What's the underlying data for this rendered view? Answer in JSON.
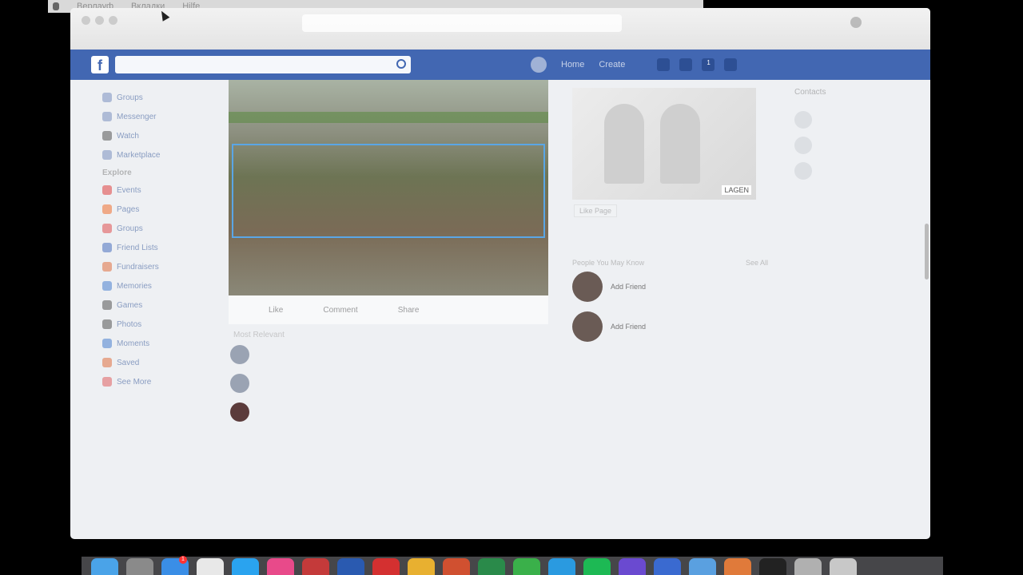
{
  "menubar": {
    "items": [
      "Верлауф",
      "Вкладки",
      "Hilfe"
    ]
  },
  "fb": {
    "logo": "f",
    "nav_items": [
      "Home",
      "Create"
    ],
    "notif_count": "1"
  },
  "left_sidebar": {
    "items": [
      {
        "label": "Groups",
        "color": "#7a90c0"
      },
      {
        "label": "Messenger",
        "color": "#7a90c0"
      },
      {
        "label": "Watch",
        "color": "#555"
      },
      {
        "label": "Marketplace",
        "color": "#7a90c0"
      }
    ],
    "explore_header": "Explore",
    "explore": [
      {
        "label": "Events",
        "color": "#e04040"
      },
      {
        "label": "Pages",
        "color": "#f07030"
      },
      {
        "label": "Groups",
        "color": "#e05050"
      },
      {
        "label": "Friend Lists",
        "color": "#4a70c0"
      },
      {
        "label": "Fundraisers",
        "color": "#e07040"
      },
      {
        "label": "Memories",
        "color": "#4a80d0"
      },
      {
        "label": "Games",
        "color": "#555"
      },
      {
        "label": "Photos",
        "color": "#555"
      },
      {
        "label": "Moments",
        "color": "#4a80d0"
      },
      {
        "label": "Saved",
        "color": "#e07040"
      },
      {
        "label": "See More",
        "color": "#e06060"
      }
    ]
  },
  "post": {
    "actions": [
      "Like",
      "Comment",
      "Share"
    ],
    "comments_header": "Most Relevant",
    "comments": [
      {
        "name": "",
        "text": "",
        "dark": false
      },
      {
        "name": "",
        "text": "",
        "dark": false
      },
      {
        "name": "",
        "text": "",
        "dark": true
      }
    ]
  },
  "right_column": {
    "ad_tag": "LAGEN",
    "ad_button": "Like Page",
    "people_header": "People You May Know",
    "see_all": "See All",
    "people": [
      {
        "name": "",
        "sub": "Add Friend"
      },
      {
        "name": "",
        "sub": "Add Friend"
      }
    ]
  },
  "chat": {
    "header": "Contacts",
    "contacts": [
      "",
      "",
      ""
    ],
    "bottom": ""
  },
  "dock": {
    "apps": [
      {
        "name": "finder",
        "color": "#4aa3e8"
      },
      {
        "name": "launchpad",
        "color": "#8a8a8a"
      },
      {
        "name": "app-store",
        "color": "#3a8ee6",
        "badge": "1"
      },
      {
        "name": "calendar",
        "color": "#e8e8e8"
      },
      {
        "name": "twitter",
        "color": "#2aa3ef"
      },
      {
        "name": "itunes",
        "color": "#e84a8a"
      },
      {
        "name": "office",
        "color": "#c43a3a"
      },
      {
        "name": "word",
        "color": "#2a5ab0"
      },
      {
        "name": "acrobat",
        "color": "#d43030"
      },
      {
        "name": "chrome",
        "color": "#e8b030"
      },
      {
        "name": "powerpoint",
        "color": "#d05030"
      },
      {
        "name": "excel",
        "color": "#2a8a4a"
      },
      {
        "name": "upwork",
        "color": "#3ab04a"
      },
      {
        "name": "telegram",
        "color": "#2a9ae0"
      },
      {
        "name": "spotify",
        "color": "#1db954"
      },
      {
        "name": "imovie",
        "color": "#6a4ad0"
      },
      {
        "name": "mail",
        "color": "#3a6ad0"
      },
      {
        "name": "folder",
        "color": "#5aa0e0"
      },
      {
        "name": "preview",
        "color": "#e07a3a"
      },
      {
        "name": "terminal",
        "color": "#222"
      },
      {
        "name": "downloads",
        "color": "#b0b0b0"
      },
      {
        "name": "trash",
        "color": "#c8c8c8"
      }
    ]
  }
}
